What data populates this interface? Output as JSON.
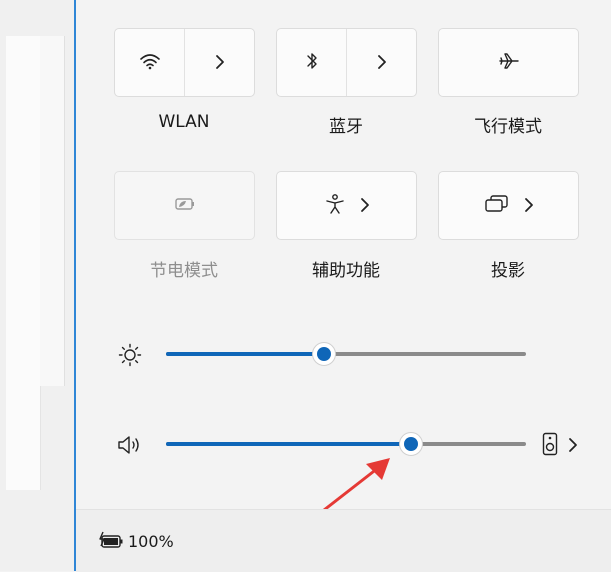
{
  "tiles": {
    "wlan": {
      "label": "WLAN",
      "icon": "wifi-icon",
      "active": false
    },
    "bluetooth": {
      "label": "蓝牙",
      "icon": "bluetooth-icon",
      "active": false
    },
    "airplane": {
      "label": "飞行模式",
      "icon": "airplane-icon",
      "active": false
    },
    "battery_saver": {
      "label": "节电模式",
      "icon": "battery-saver-icon",
      "enabled": false
    },
    "accessibility": {
      "label": "辅助功能",
      "icon": "accessibility-icon"
    },
    "project": {
      "label": "投影",
      "icon": "project-icon"
    }
  },
  "sliders": {
    "brightness": {
      "icon": "sun-icon",
      "value_percent": 44
    },
    "volume": {
      "icon": "speaker-icon",
      "value_percent": 68,
      "output_icon": "speaker-device-icon"
    }
  },
  "footer": {
    "battery_text": "100%",
    "battery_icon": "battery-charging-icon"
  },
  "colors": {
    "accent": "#0f66b8",
    "track": "#8a8a8a",
    "annotation_arrow": "#e53935"
  }
}
